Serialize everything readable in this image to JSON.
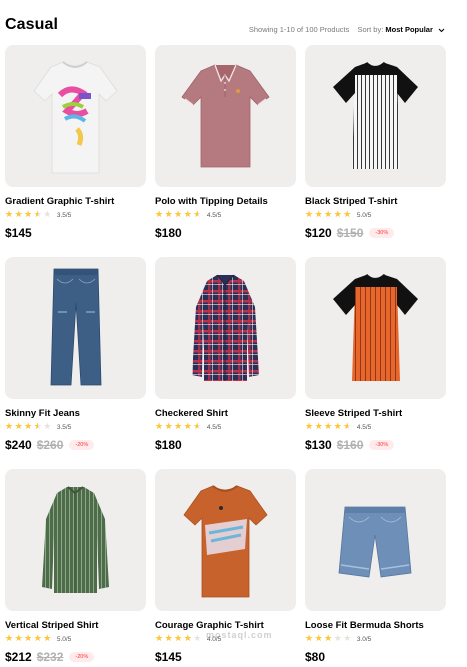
{
  "header": {
    "title": "Casual",
    "results": "Showing 1-10 of 100 Products",
    "sort_label": "Sort by:",
    "sort_value": "Most Popular",
    "sort_icon": "chevron-down-icon"
  },
  "colors": {
    "star": "#ffc633",
    "card_bg": "#f0eeed",
    "discount_text": "#ff3333",
    "discount_bg": "#ffebeb",
    "old_price": "#b1b1b1"
  },
  "products": [
    {
      "name": "Gradient Graphic T-shirt",
      "rating": 3.5,
      "rating_text": "3.5/5",
      "price": "$145",
      "old_price": "",
      "discount": "",
      "icon": "tshirt-graphic-icon"
    },
    {
      "name": "Polo with Tipping Details",
      "rating": 4.5,
      "rating_text": "4.5/5",
      "price": "$180",
      "old_price": "",
      "discount": "",
      "icon": "polo-shirt-icon"
    },
    {
      "name": "Black Striped T-shirt",
      "rating": 5.0,
      "rating_text": "5.0/5",
      "price": "$120",
      "old_price": "$150",
      "discount": "-30%",
      "icon": "striped-tshirt-icon"
    },
    {
      "name": "Skinny Fit Jeans",
      "rating": 3.5,
      "rating_text": "3.5/5",
      "price": "$240",
      "old_price": "$260",
      "discount": "-20%",
      "icon": "jeans-icon"
    },
    {
      "name": "Checkered Shirt",
      "rating": 4.5,
      "rating_text": "4.5/5",
      "price": "$180",
      "old_price": "",
      "discount": "",
      "icon": "checkered-shirt-icon"
    },
    {
      "name": "Sleeve Striped T-shirt",
      "rating": 4.5,
      "rating_text": "4.5/5",
      "price": "$130",
      "old_price": "$160",
      "discount": "-30%",
      "icon": "raglan-tshirt-icon"
    },
    {
      "name": "Vertical Striped Shirt",
      "rating": 5.0,
      "rating_text": "5.0/5",
      "price": "$212",
      "old_price": "$232",
      "discount": "-20%",
      "icon": "striped-shirt-icon"
    },
    {
      "name": "Courage Graphic T-shirt",
      "rating": 4.0,
      "rating_text": "4.0/5",
      "price": "$145",
      "old_price": "",
      "discount": "",
      "icon": "tshirt-graphic-icon"
    },
    {
      "name": "Loose Fit Bermuda Shorts",
      "rating": 3.0,
      "rating_text": "3.0/5",
      "price": "$80",
      "old_price": "",
      "discount": "",
      "icon": "shorts-icon"
    }
  ],
  "watermark": "mostaql.com"
}
